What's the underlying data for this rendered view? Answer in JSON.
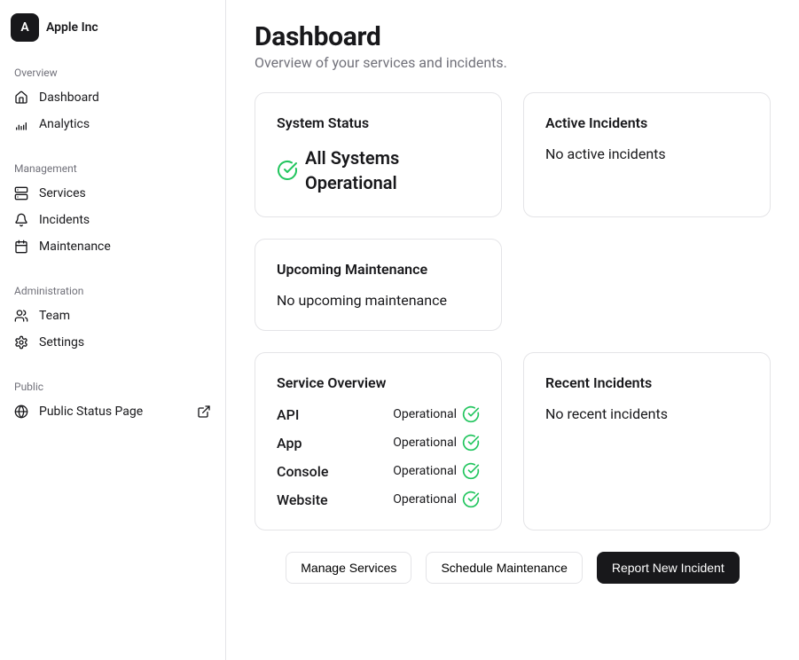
{
  "org": {
    "avatar_letter": "A",
    "name": "Apple Inc"
  },
  "sidebar": {
    "sections": [
      {
        "label": "Overview",
        "items": [
          {
            "label": "Dashboard"
          },
          {
            "label": "Analytics"
          }
        ]
      },
      {
        "label": "Management",
        "items": [
          {
            "label": "Services"
          },
          {
            "label": "Incidents"
          },
          {
            "label": "Maintenance"
          }
        ]
      },
      {
        "label": "Administration",
        "items": [
          {
            "label": "Team"
          },
          {
            "label": "Settings"
          }
        ]
      },
      {
        "label": "Public",
        "items": [
          {
            "label": "Public Status Page"
          }
        ]
      }
    ]
  },
  "page": {
    "title": "Dashboard",
    "subtitle": "Overview of your services and incidents."
  },
  "cards": {
    "system_status": {
      "title": "System Status",
      "status": "All Systems Operational"
    },
    "active_incidents": {
      "title": "Active Incidents",
      "empty": "No active incidents"
    },
    "upcoming_maintenance": {
      "title": "Upcoming Maintenance",
      "empty": "No upcoming maintenance"
    },
    "service_overview": {
      "title": "Service Overview",
      "services": [
        {
          "name": "API",
          "status": "Operational"
        },
        {
          "name": "App",
          "status": "Operational"
        },
        {
          "name": "Console",
          "status": "Operational"
        },
        {
          "name": "Website",
          "status": "Operational"
        }
      ]
    },
    "recent_incidents": {
      "title": "Recent Incidents",
      "empty": "No recent incidents"
    }
  },
  "actions": {
    "manage_services": "Manage Services",
    "schedule_maintenance": "Schedule Maintenance",
    "report_incident": "Report New Incident"
  }
}
